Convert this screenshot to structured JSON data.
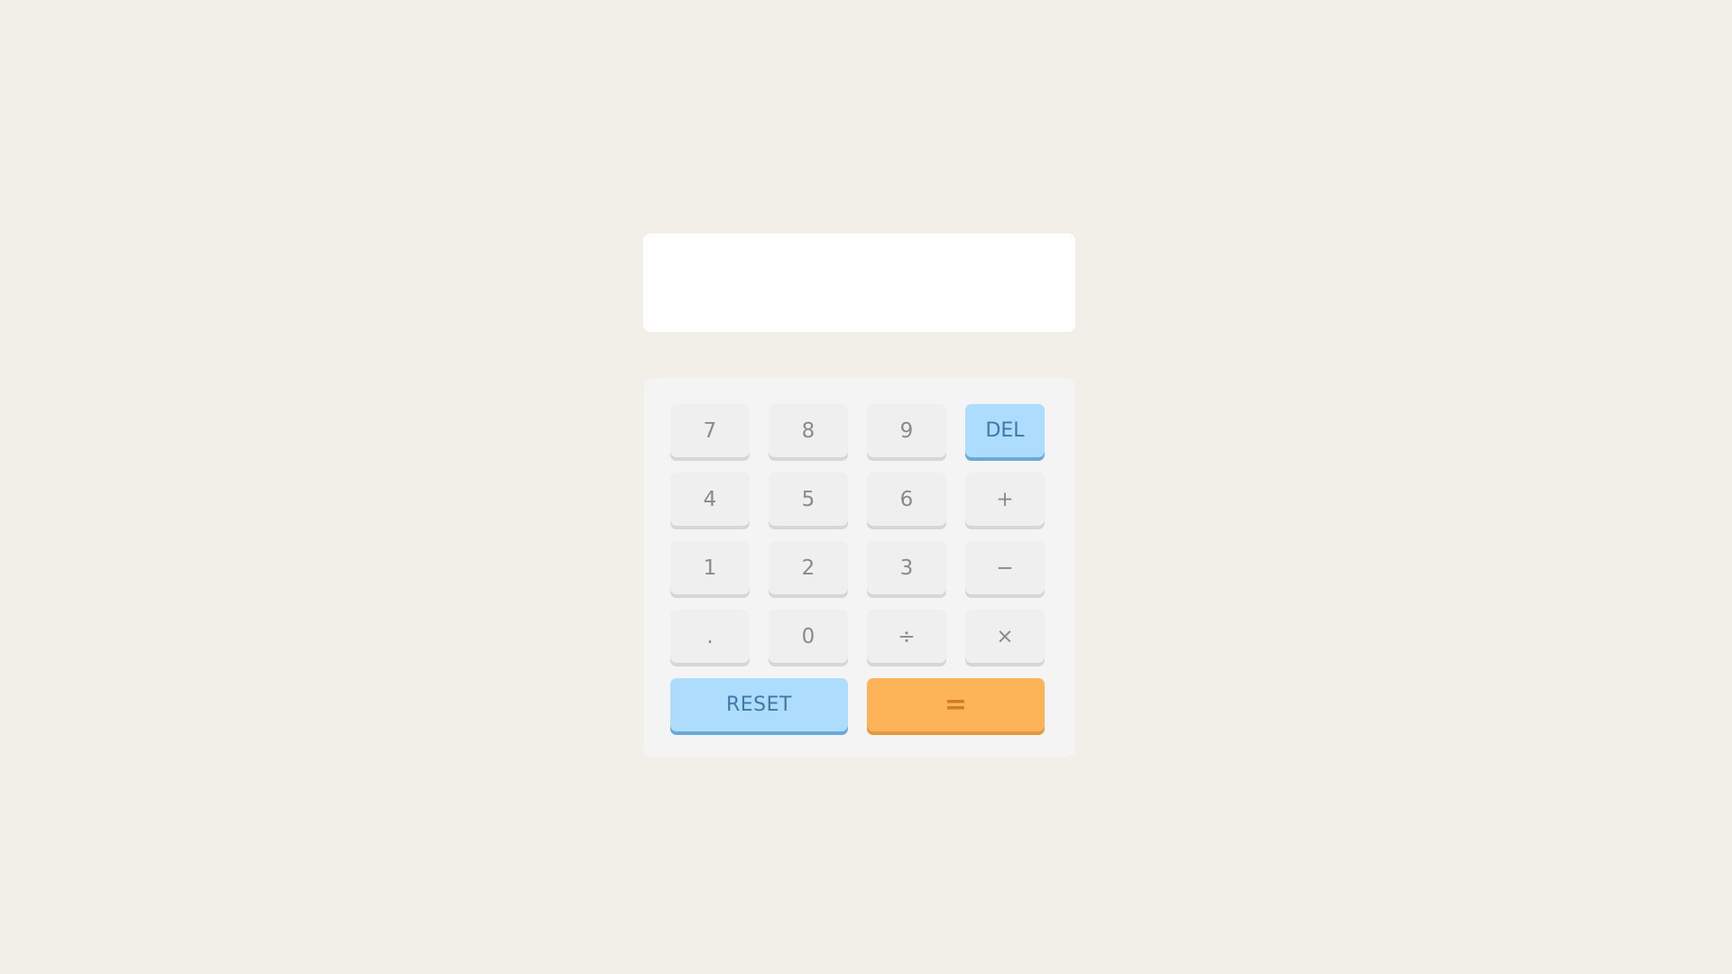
{
  "display": {
    "value": ""
  },
  "keys": {
    "seven": "7",
    "eight": "8",
    "nine": "9",
    "del": "DEL",
    "four": "4",
    "five": "5",
    "six": "6",
    "plus": "+",
    "one": "1",
    "two": "2",
    "three": "3",
    "minus": "−",
    "dot": ".",
    "zero": "0",
    "divide": "÷",
    "multiply": "×",
    "reset": "RESET",
    "equals": "="
  },
  "colors": {
    "background": "#f2efe9",
    "display": "#ffffff",
    "keypad": "#f4f4f4",
    "key": "#efefef",
    "key_text": "#8a8a8a",
    "accent_blue": "#aedcfc",
    "accent_blue_text": "#3f79aa",
    "accent_orange": "#fdb357",
    "accent_orange_text": "#cf7f22"
  }
}
